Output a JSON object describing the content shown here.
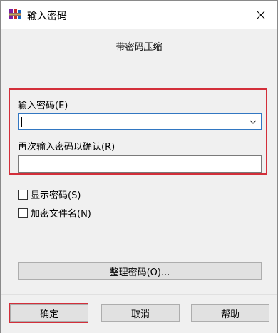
{
  "window": {
    "title": "输入密码",
    "icon": "winrar-books-icon",
    "close_glyph": "✕"
  },
  "content": {
    "subtitle": "带密码压缩",
    "password_label": "输入密码(E)",
    "password_value": "",
    "confirm_label": "再次输入密码以确认(R)",
    "confirm_value": "",
    "show_password_label": "显示密码(S)",
    "show_password_checked": false,
    "encrypt_filenames_label": "加密文件名(N)",
    "encrypt_filenames_checked": false,
    "organize_button": "整理密码(O)..."
  },
  "footer": {
    "ok": "确定",
    "cancel": "取消",
    "help": "帮助"
  },
  "colors": {
    "highlight_red": "#d32f3a",
    "focus_blue": "#3277c2",
    "panel_gray": "#f0f0f0"
  }
}
